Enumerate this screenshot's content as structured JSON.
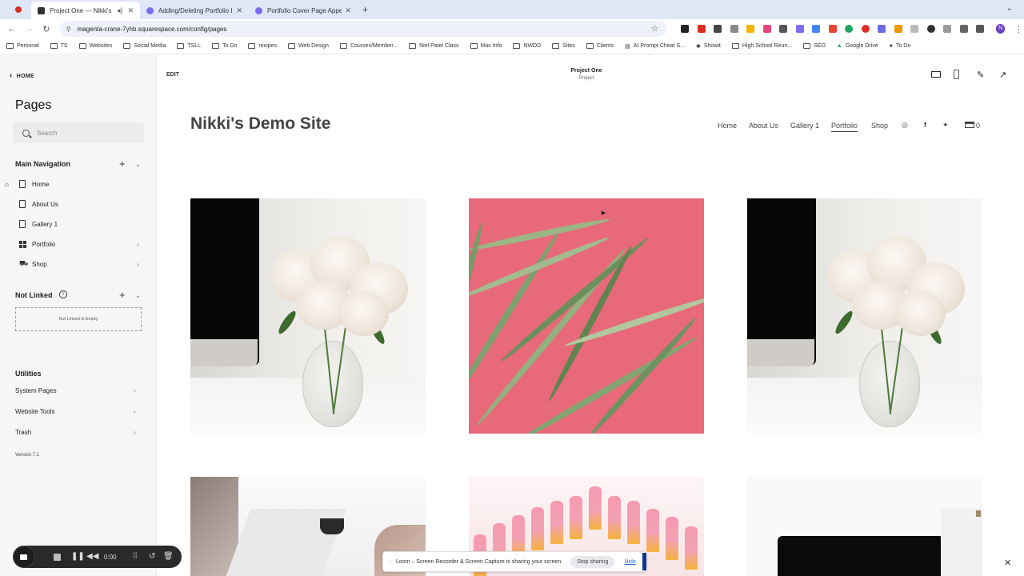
{
  "browser": {
    "tabs": [
      {
        "title": "Project One — Nikki's Demo Site",
        "active": true
      },
      {
        "title": "Adding/Deleting Portfolio Images",
        "active": false
      },
      {
        "title": "Portfolio Cover Page Appearance",
        "active": false
      }
    ],
    "url": "magenta-crane-7yhb.squarespace.com/config/pages",
    "bookmarks": [
      "Personal",
      "TS",
      "Websites",
      "Social Media",
      "TSLL",
      "To Do",
      "recipes",
      "Web Design",
      "Courses/Member...",
      "Niel Patel Class",
      "Mac Info",
      "NWDD",
      "Sites",
      "Clients",
      "AI Prompt Cheat S...",
      "Showit",
      "High School Reun...",
      "SEO",
      "Google Drive",
      "To Do"
    ],
    "profile_initial": "N"
  },
  "sidebar": {
    "back_label": "HOME",
    "title": "Pages",
    "search_placeholder": "Search",
    "main_nav": {
      "heading": "Main Navigation",
      "items": [
        {
          "label": "Home"
        },
        {
          "label": "About Us"
        },
        {
          "label": "Gallery 1"
        },
        {
          "label": "Portfolio"
        },
        {
          "label": "Shop"
        }
      ]
    },
    "not_linked": {
      "heading": "Not Linked",
      "empty_text": "Not Linked is Empty"
    },
    "utilities": {
      "heading": "Utilities",
      "items": [
        {
          "label": "System Pages"
        },
        {
          "label": "Website Tools"
        },
        {
          "label": "Trash"
        }
      ]
    },
    "version": "Version 7.1"
  },
  "editor": {
    "edit_label": "EDIT",
    "page_title": "Project One",
    "page_type": "Project"
  },
  "site": {
    "title": "Nikki's Demo Site",
    "nav": [
      "Home",
      "About Us",
      "Gallery 1",
      "Portfolio",
      "Shop"
    ],
    "current_nav": "Portfolio",
    "cart_count": "0"
  },
  "loom": {
    "timer": "0:00",
    "share_text": "Loom – Screen Recorder & Screen Capture is sharing your screen.",
    "stop_label": "Stop sharing",
    "hide_label": "Hide"
  },
  "colors": {
    "accent_pink": "#e8697a",
    "profile": "#6b3fc3",
    "link_blue": "#1a73e8"
  }
}
